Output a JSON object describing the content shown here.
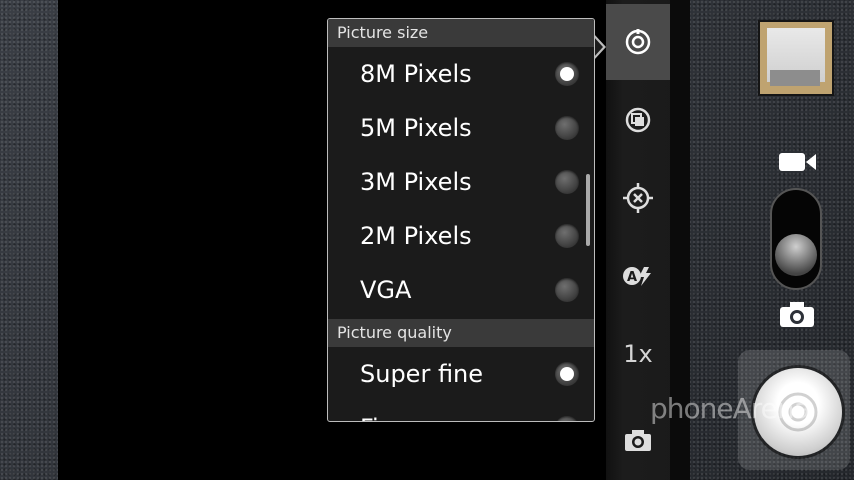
{
  "menu": {
    "sections": [
      {
        "title": "Picture size",
        "options": [
          {
            "label": "8M Pixels",
            "selected": true
          },
          {
            "label": "5M Pixels",
            "selected": false
          },
          {
            "label": "3M Pixels",
            "selected": false
          },
          {
            "label": "2M Pixels",
            "selected": false
          },
          {
            "label": "VGA",
            "selected": false
          }
        ]
      },
      {
        "title": "Picture quality",
        "options": [
          {
            "label": "Super fine",
            "selected": true
          },
          {
            "label": "Fi",
            "selected": false
          }
        ]
      }
    ]
  },
  "rail": {
    "items": [
      {
        "icon": "settings-dial-icon",
        "active": true
      },
      {
        "icon": "scene-mode-icon",
        "active": false
      },
      {
        "icon": "focus-target-icon",
        "active": false
      },
      {
        "icon": "auto-flash-icon",
        "active": false
      },
      {
        "icon": "zoom-level",
        "active": false
      },
      {
        "icon": "camera-settings-icon",
        "active": false
      }
    ],
    "zoom_label": "1x"
  },
  "mode_switch": {
    "top_icon": "video-camera-icon",
    "bottom_icon": "still-camera-icon",
    "mode": "camera"
  },
  "watermark": "phoneArena"
}
